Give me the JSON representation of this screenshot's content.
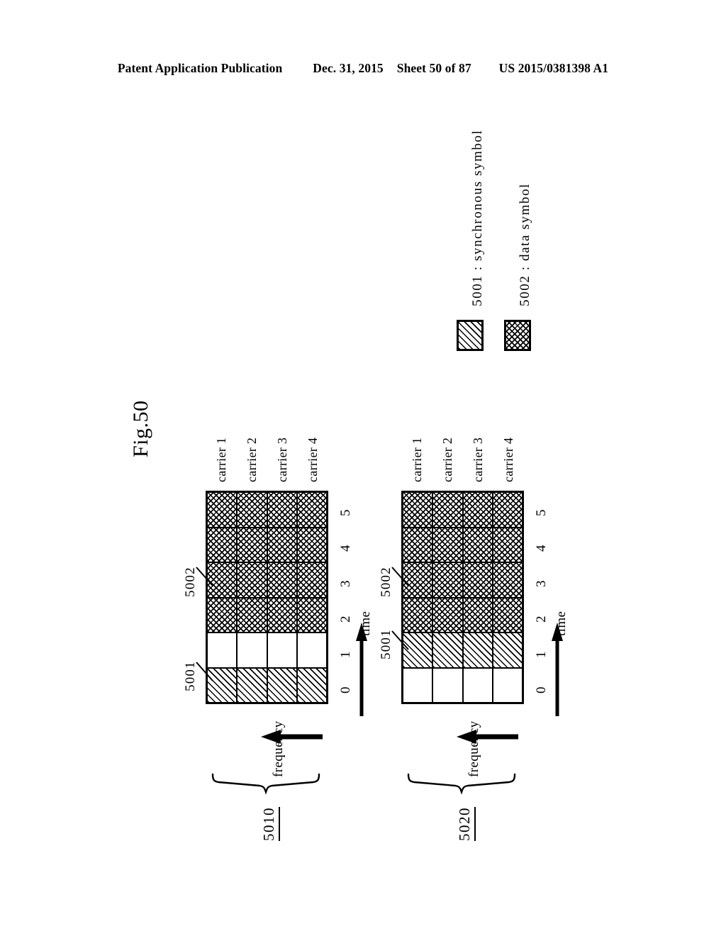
{
  "header": {
    "publication": "Patent Application Publication",
    "date": "Dec. 31, 2015",
    "sheet": "Sheet 50 of 87",
    "patent_number": "US 2015/0381398 A1"
  },
  "figure": {
    "label": "Fig.50"
  },
  "legend": {
    "items": [
      {
        "ref": "5001",
        "separator": ":",
        "text": "synchronous symbol",
        "fill": "sync"
      },
      {
        "ref": "5002",
        "separator": ":",
        "text": "data symbol",
        "fill": "data"
      }
    ],
    "line1": "5001 : synchronous symbol",
    "line2": "5002 : data symbol"
  },
  "axes": {
    "time_label": "time",
    "frequency_label": "frequency",
    "time_ticks": [
      "0",
      "1",
      "2",
      "3",
      "4",
      "5"
    ],
    "carrier_labels": [
      "carrier 1",
      "carrier 2",
      "carrier 3",
      "carrier 4"
    ]
  },
  "blocks": [
    {
      "id": "5010",
      "ref_sync": "5001",
      "ref_data": "5002",
      "grid": [
        [
          "sync",
          "empty",
          "data",
          "data",
          "data",
          "data"
        ],
        [
          "sync",
          "empty",
          "data",
          "data",
          "data",
          "data"
        ],
        [
          "sync",
          "empty",
          "data",
          "data",
          "data",
          "data"
        ],
        [
          "sync",
          "empty",
          "data",
          "data",
          "data",
          "data"
        ]
      ]
    },
    {
      "id": "5020",
      "ref_sync": "5001",
      "ref_data": "5002",
      "grid": [
        [
          "empty",
          "sync",
          "data",
          "data",
          "data",
          "data"
        ],
        [
          "empty",
          "sync",
          "data",
          "data",
          "data",
          "data"
        ],
        [
          "empty",
          "sync",
          "data",
          "data",
          "data",
          "data"
        ],
        [
          "empty",
          "sync",
          "data",
          "data",
          "data",
          "data"
        ]
      ]
    }
  ],
  "chart_data": {
    "type": "heatmap",
    "title": "Fig.50",
    "xlabel": "time",
    "ylabel": "frequency",
    "x": [
      "0",
      "1",
      "2",
      "3",
      "4",
      "5"
    ],
    "y": [
      "carrier 1",
      "carrier 2",
      "carrier 3",
      "carrier 4"
    ],
    "legend": [
      "5001 : synchronous symbol",
      "5002 : data symbol"
    ],
    "series": [
      {
        "name": "5010",
        "values": [
          [
            "sync",
            "empty",
            "data",
            "data",
            "data",
            "data"
          ],
          [
            "sync",
            "empty",
            "data",
            "data",
            "data",
            "data"
          ],
          [
            "sync",
            "empty",
            "data",
            "data",
            "data",
            "data"
          ],
          [
            "sync",
            "empty",
            "data",
            "data",
            "data",
            "data"
          ]
        ]
      },
      {
        "name": "5020",
        "values": [
          [
            "empty",
            "sync",
            "data",
            "data",
            "data",
            "data"
          ],
          [
            "empty",
            "sync",
            "data",
            "data",
            "data",
            "data"
          ],
          [
            "empty",
            "sync",
            "data",
            "data",
            "data",
            "data"
          ],
          [
            "empty",
            "sync",
            "data",
            "data",
            "data",
            "data"
          ]
        ]
      }
    ]
  }
}
